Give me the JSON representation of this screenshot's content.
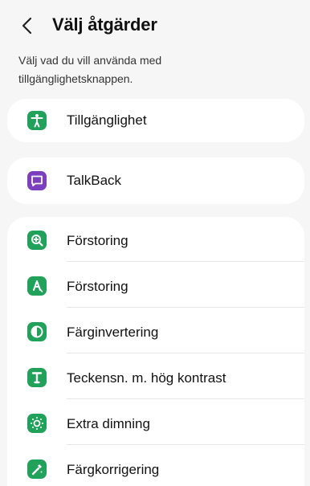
{
  "header": {
    "title": "Välj åtgärder",
    "back_icon": "chevron-left-icon"
  },
  "description": "Välj vad du vill använda med tillgänglighetsknappen.",
  "colors": {
    "background": "#f6f6f6",
    "card": "#ffffff",
    "green": "#21a15a",
    "purple": "#7b3fbf",
    "divider": "#e6e6e6"
  },
  "items": [
    {
      "label": "Tillgänglighet",
      "icon": "accessibility-person-icon"
    },
    {
      "label": "TalkBack",
      "icon": "speech-bubble-icon"
    },
    {
      "label": "Förstoring",
      "icon": "magnifier-plus-icon"
    },
    {
      "label": "Förstoring",
      "icon": "magnify-text-icon"
    },
    {
      "label": "Färginvertering",
      "icon": "contrast-circle-icon"
    },
    {
      "label": "Teckensn. m. hög kontrast",
      "icon": "high-contrast-font-icon"
    },
    {
      "label": "Extra dimning",
      "icon": "dimming-sun-icon"
    },
    {
      "label": "Färgkorrigering",
      "icon": "color-correction-icon"
    }
  ]
}
